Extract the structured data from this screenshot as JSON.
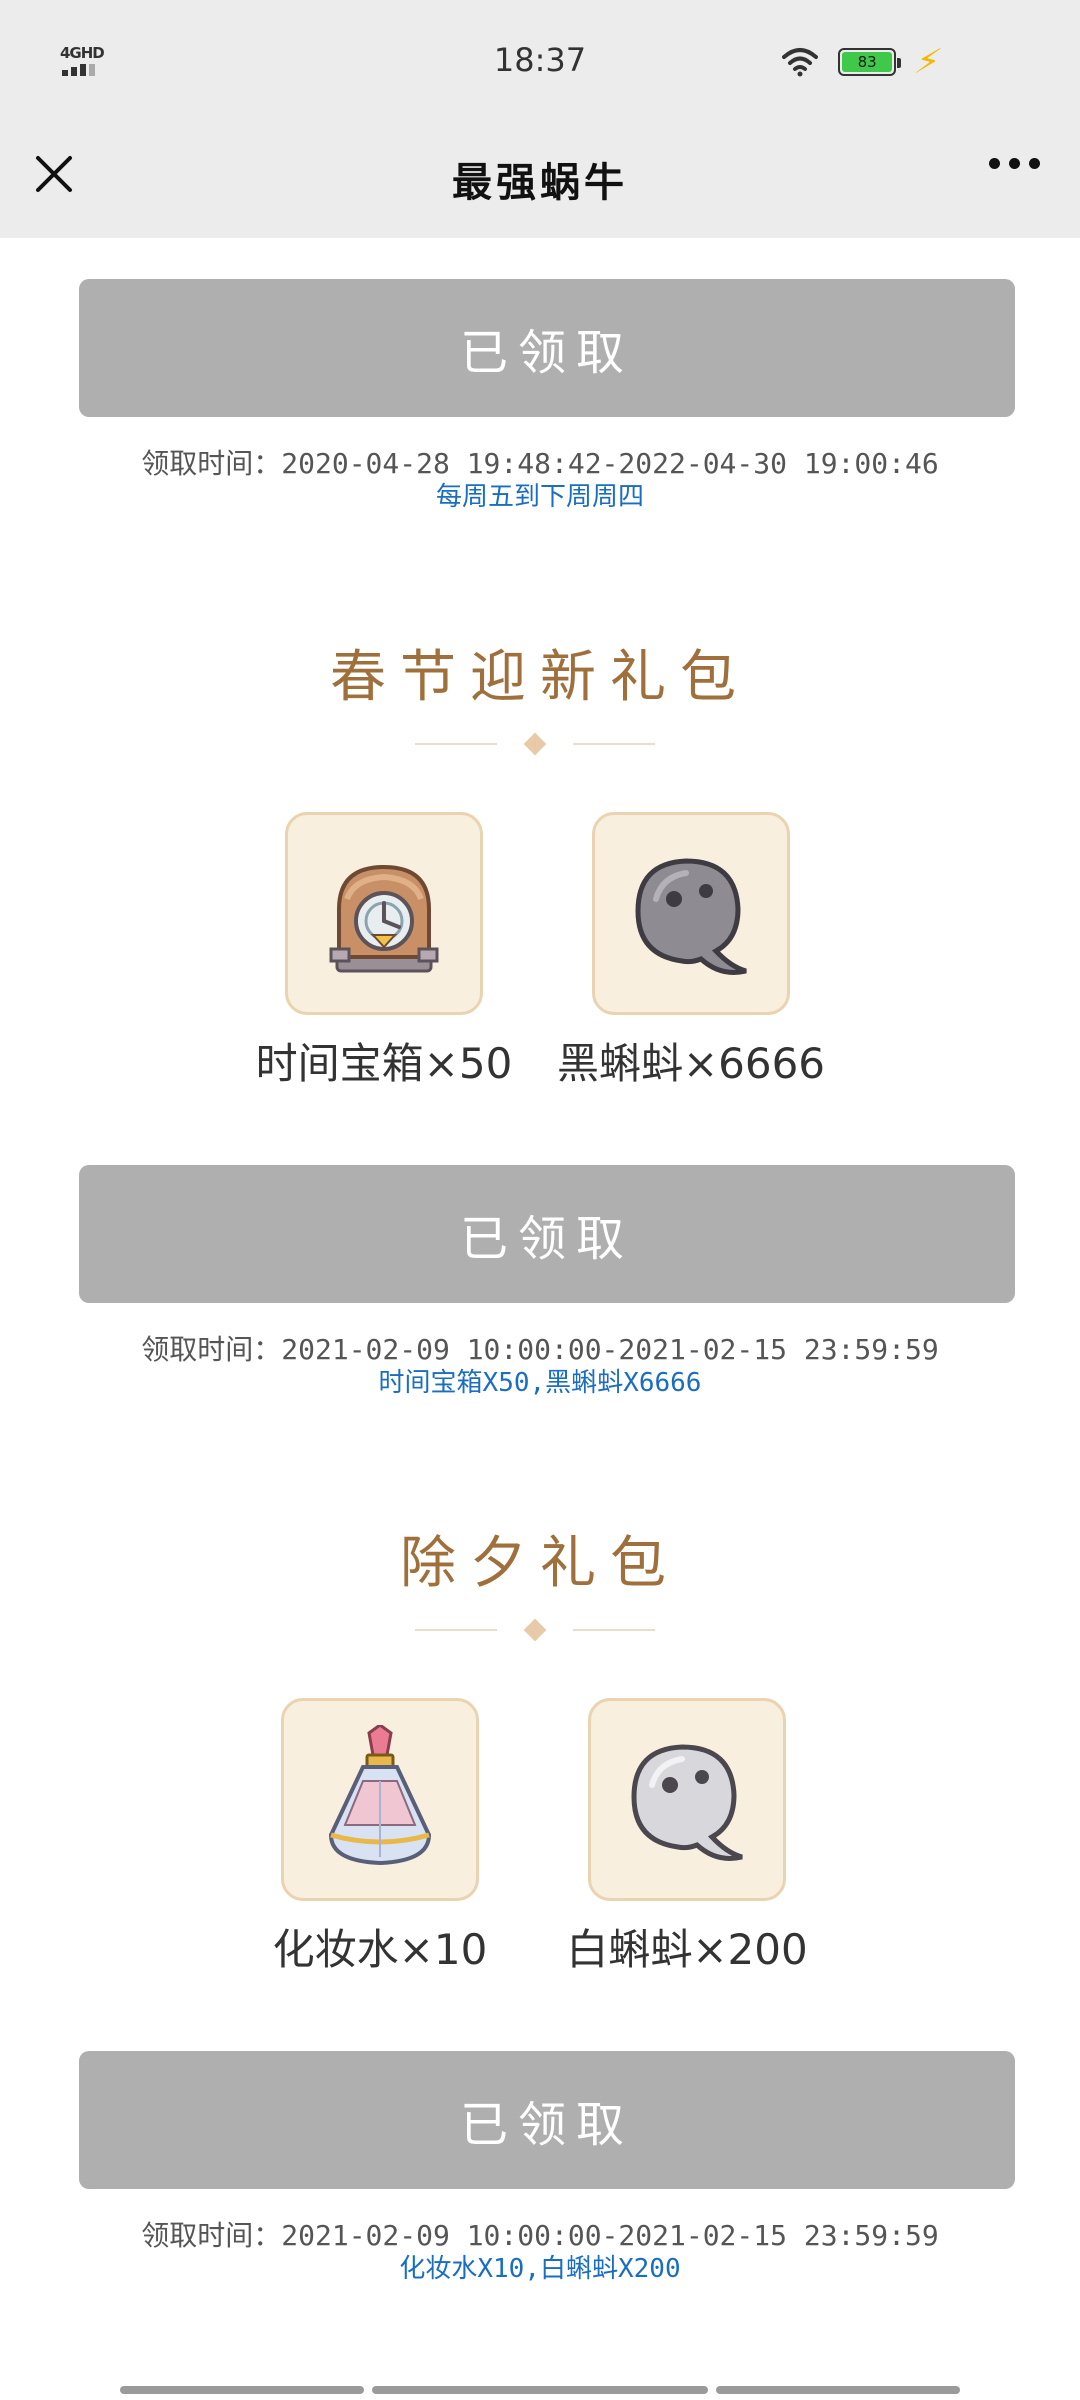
{
  "status_bar": {
    "network": "4GHD",
    "time": "18:37",
    "battery": "83"
  },
  "nav": {
    "title": "最强蜗牛"
  },
  "sections": [
    {
      "button_label": "已领取",
      "claim_time": "领取时间：2020-04-28 19:48:42-2022-04-30 19:00:46",
      "description": "每周五到下周周四"
    },
    {
      "title": "春节迎新礼包",
      "items": [
        {
          "name": "时间宝箱×50",
          "icon": "time-chest-icon"
        },
        {
          "name": "黑蝌蚪×6666",
          "icon": "black-tadpole-icon"
        }
      ],
      "button_label": "已领取",
      "claim_time": "领取时间：2021-02-09 10:00:00-2021-02-15 23:59:59",
      "description": "时间宝箱X50,黑蝌蚪X6666"
    },
    {
      "title": "除夕礼包",
      "items": [
        {
          "name": "化妆水×10",
          "icon": "lotion-bottle-icon"
        },
        {
          "name": "白蝌蚪×200",
          "icon": "white-tadpole-icon"
        }
      ],
      "button_label": "已领取",
      "claim_time": "领取时间：2021-02-09 10:00:00-2021-02-15 23:59:59",
      "description": "化妆水X10,白蝌蚪X200"
    }
  ],
  "colors": {
    "header_bg": "#ececec",
    "claimed_button": "#afafaf",
    "section_title": "#a0703c",
    "description_link": "#1a6ec2",
    "tile_bg": "#f8efdf"
  }
}
